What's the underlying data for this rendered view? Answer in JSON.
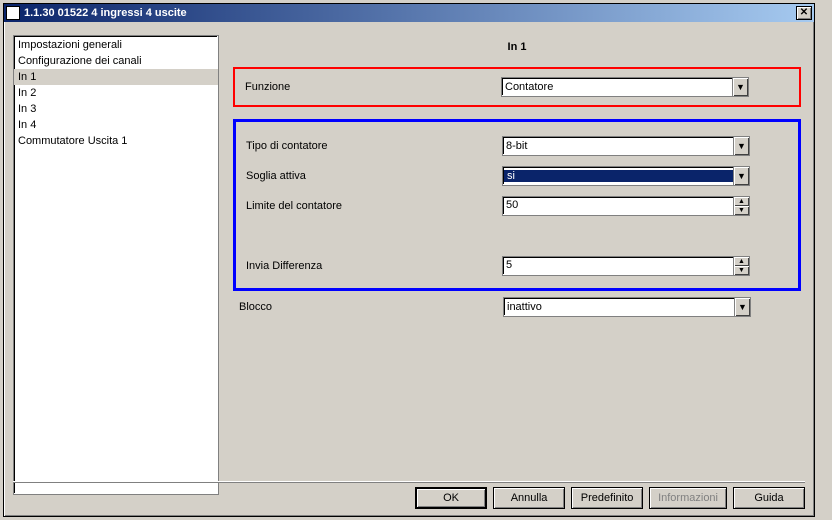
{
  "window": {
    "title": "1.1.30 01522 4 ingressi 4 uscite"
  },
  "sidebar": {
    "items": [
      {
        "label": "Impostazioni generali",
        "selected": false
      },
      {
        "label": "Configurazione dei canali",
        "selected": false
      },
      {
        "label": "In 1",
        "selected": true
      },
      {
        "label": "In 2",
        "selected": false
      },
      {
        "label": "In 3",
        "selected": false
      },
      {
        "label": "In 4",
        "selected": false
      },
      {
        "label": "Commutatore Uscita 1",
        "selected": false
      }
    ]
  },
  "page": {
    "title": "In 1"
  },
  "fields": {
    "funzione": {
      "label": "Funzione",
      "value": "Contatore"
    },
    "tipo": {
      "label": "Tipo di contatore",
      "value": "8-bit"
    },
    "soglia": {
      "label": "Soglia attiva",
      "value": "si"
    },
    "limite": {
      "label": "Limite del contatore",
      "value": "50"
    },
    "differenza": {
      "label": "Invia Differenza",
      "value": "5"
    },
    "blocco": {
      "label": "Blocco",
      "value": "inattivo"
    }
  },
  "buttons": {
    "ok": "OK",
    "annulla": "Annulla",
    "predefinito": "Predefinito",
    "informazioni": "Informazioni",
    "guida": "Guida"
  }
}
